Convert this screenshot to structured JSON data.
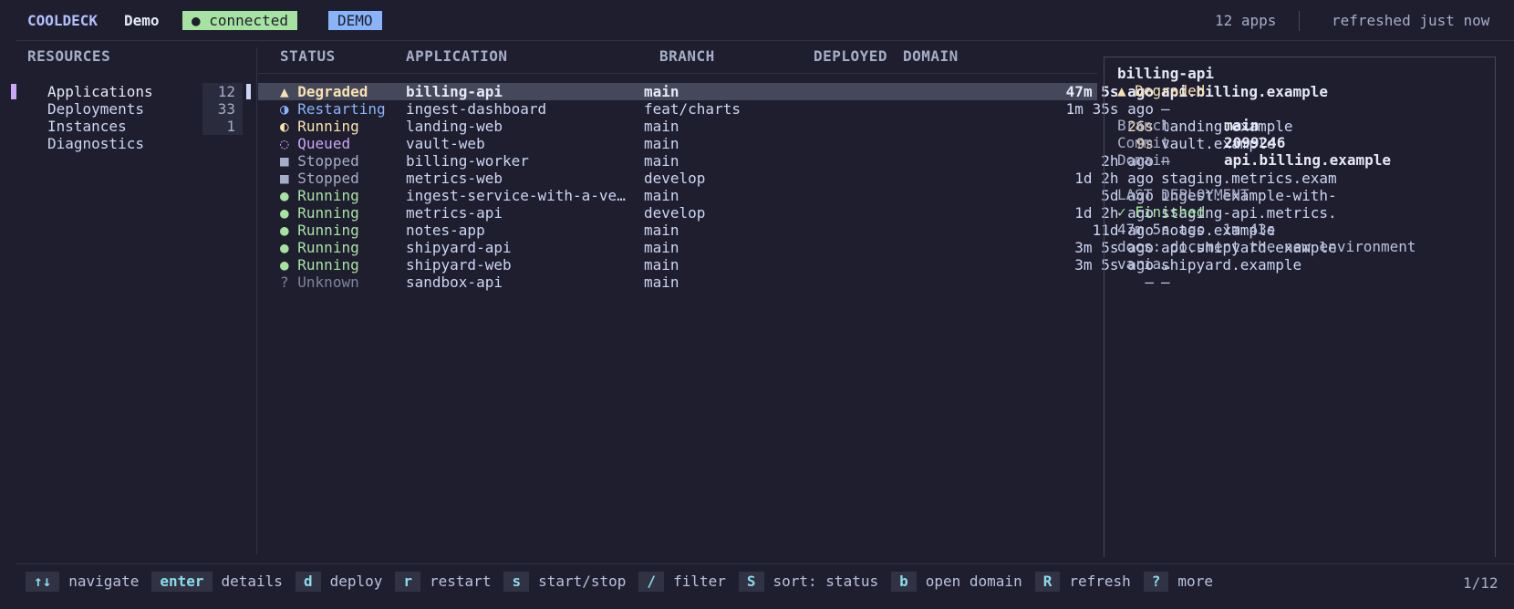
{
  "topbar": {
    "brand": "COOLDECK",
    "workspace": "Demo",
    "connection": "● connected",
    "mode": "DEMO",
    "app_count": "12 apps",
    "refreshed": "refreshed just now"
  },
  "sidebar": {
    "header": "RESOURCES",
    "items": [
      {
        "label": "Applications",
        "count": "12"
      },
      {
        "label": "Deployments",
        "count": "33"
      },
      {
        "label": "Instances",
        "count": "1"
      },
      {
        "label": "Diagnostics",
        "count": ""
      }
    ]
  },
  "table": {
    "columns": {
      "status": "STATUS",
      "application": "APPLICATION",
      "branch": "BRANCH",
      "deployed": "DEPLOYED",
      "domain": "DOMAIN"
    },
    "rows": [
      {
        "icon": "▲",
        "status": "Degraded",
        "app": "billing-api",
        "branch": "main",
        "deployed": "47m 5s ago",
        "domain": "api.billing.example",
        "cls": "s-degraded",
        "icon_name": "warning-triangle-icon"
      },
      {
        "icon": "◑",
        "status": "Restarting",
        "app": "ingest-dashboard",
        "branch": "feat/charts",
        "deployed": "1m 35s ago",
        "domain": "–",
        "cls": "s-restarting",
        "icon_name": "half-circle-icon"
      },
      {
        "icon": "◐",
        "status": "Running",
        "app": "landing-web",
        "branch": "main",
        "deployed": "26s",
        "domain": "landing.example",
        "cls": "s-running-y",
        "icon_name": "half-circle-icon",
        "fresh": true
      },
      {
        "icon": "◌",
        "status": "Queued",
        "app": "vault-web",
        "branch": "main",
        "deployed": "9s",
        "domain": "vault.example",
        "cls": "s-queued",
        "icon_name": "dotted-circle-icon",
        "fresh": true
      },
      {
        "icon": "■",
        "status": "Stopped",
        "app": "billing-worker",
        "branch": "main",
        "deployed": "2h ago",
        "domain": "–",
        "cls": "s-stopped",
        "icon_name": "square-icon"
      },
      {
        "icon": "■",
        "status": "Stopped",
        "app": "metrics-web",
        "branch": "develop",
        "deployed": "1d 2h ago",
        "domain": "staging.metrics.exam",
        "cls": "s-stopped",
        "icon_name": "square-icon"
      },
      {
        "icon": "●",
        "status": "Running",
        "app": "ingest-service-with-a-ve…",
        "branch": "main",
        "deployed": "5d ago",
        "domain": "ingest.example-with-",
        "cls": "s-running",
        "icon_name": "dot-icon"
      },
      {
        "icon": "●",
        "status": "Running",
        "app": "metrics-api",
        "branch": "develop",
        "deployed": "1d 2h ago",
        "domain": "staging-api.metrics.",
        "cls": "s-running",
        "icon_name": "dot-icon"
      },
      {
        "icon": "●",
        "status": "Running",
        "app": "notes-app",
        "branch": "main",
        "deployed": "11d ago",
        "domain": "notes.example",
        "cls": "s-running",
        "icon_name": "dot-icon"
      },
      {
        "icon": "●",
        "status": "Running",
        "app": "shipyard-api",
        "branch": "main",
        "deployed": "3m 5s ago",
        "domain": "api.shipyard.example",
        "cls": "s-running",
        "icon_name": "dot-icon"
      },
      {
        "icon": "●",
        "status": "Running",
        "app": "shipyard-web",
        "branch": "main",
        "deployed": "3m 5s ago",
        "domain": "shipyard.example",
        "cls": "s-running",
        "icon_name": "dot-icon"
      },
      {
        "icon": "?",
        "status": "Unknown",
        "app": "sandbox-api",
        "branch": "main",
        "deployed": "–",
        "domain": "–",
        "cls": "s-unknown",
        "icon_name": "question-icon"
      }
    ]
  },
  "detail": {
    "title": "billing-api",
    "status": "▲ Degraded",
    "branch_label": "Branch",
    "branch": "main",
    "commit_label": "Commit",
    "commit": "2099246",
    "domain_label": "Domain",
    "domain": "api.billing.example",
    "last_header": "LAST DEPLOYMENT",
    "last_status": "✓ Finished",
    "last_meta": "47m 5s ago  1m 43s",
    "message_1": "docs: document the new environment",
    "message_2": "varia…"
  },
  "footer": {
    "hints": [
      {
        "key": "↑↓",
        "desc": "navigate"
      },
      {
        "key": "enter",
        "desc": "details"
      },
      {
        "key": "d",
        "desc": "deploy"
      },
      {
        "key": "r",
        "desc": "restart"
      },
      {
        "key": "s",
        "desc": "start/stop"
      },
      {
        "key": "/",
        "desc": "filter"
      },
      {
        "key": "S",
        "desc": "sort: status"
      },
      {
        "key": "b",
        "desc": "open domain"
      },
      {
        "key": "R",
        "desc": "refresh"
      },
      {
        "key": "?",
        "desc": "more"
      }
    ],
    "position": "1/12"
  }
}
